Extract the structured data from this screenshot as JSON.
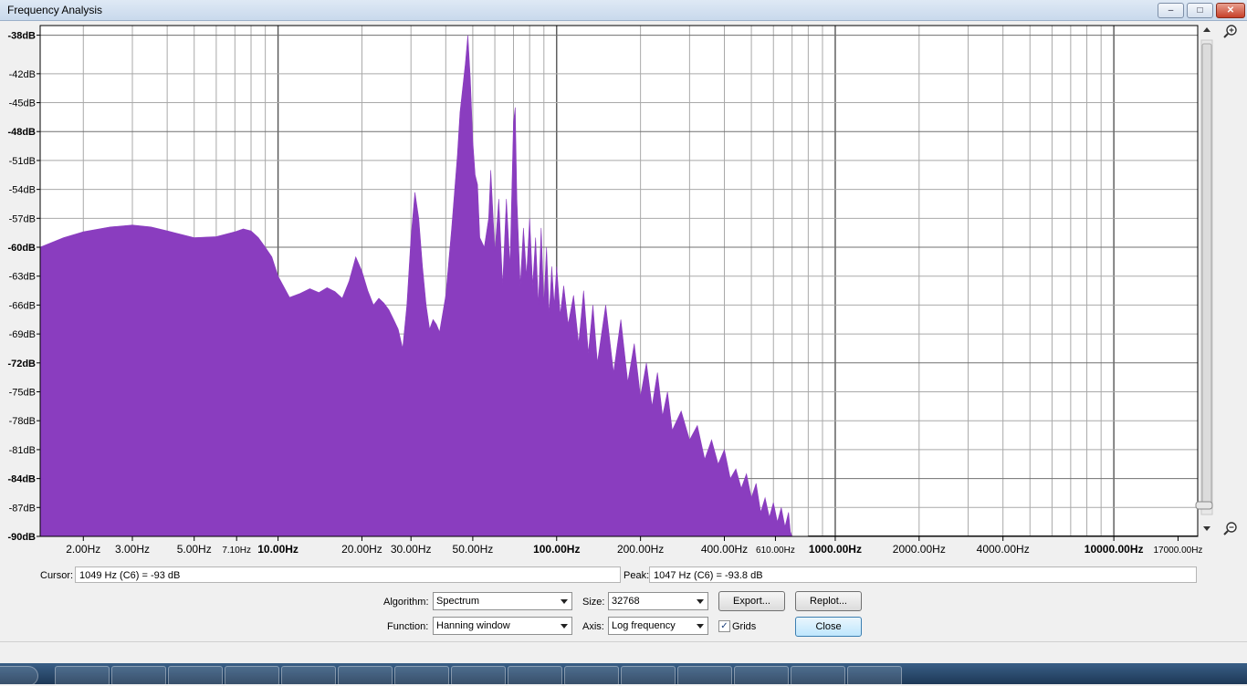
{
  "window": {
    "title": "Frequency Analysis",
    "minimize_glyph": "–",
    "maximize_glyph": "□",
    "close_glyph": "✕"
  },
  "chart_data": {
    "type": "area",
    "title": "",
    "xlabel": "",
    "ylabel": "",
    "x_scale": "log",
    "xlim": [
      1.4,
      20000
    ],
    "ylim": [
      -90,
      -37
    ],
    "grid": true,
    "fill_color": "#8a3dbf",
    "x_ticks": [
      {
        "value": 2,
        "label": "2.00Hz",
        "bold": false
      },
      {
        "value": 3,
        "label": "3.00Hz",
        "bold": false
      },
      {
        "value": 5,
        "label": "5.00Hz",
        "bold": false
      },
      {
        "value": 7.1,
        "label": "7.10Hz",
        "bold": false
      },
      {
        "value": 10,
        "label": "10.00Hz",
        "bold": true
      },
      {
        "value": 20,
        "label": "20.00Hz",
        "bold": false
      },
      {
        "value": 30,
        "label": "30.00Hz",
        "bold": false
      },
      {
        "value": 50,
        "label": "50.00Hz",
        "bold": false
      },
      {
        "value": 100,
        "label": "100.00Hz",
        "bold": true
      },
      {
        "value": 200,
        "label": "200.00Hz",
        "bold": false
      },
      {
        "value": 400,
        "label": "400.00Hz",
        "bold": false
      },
      {
        "value": 610,
        "label": "610.00Hz",
        "bold": false
      },
      {
        "value": 1000,
        "label": "1000.00Hz",
        "bold": true
      },
      {
        "value": 2000,
        "label": "2000.00Hz",
        "bold": false
      },
      {
        "value": 4000,
        "label": "4000.00Hz",
        "bold": false
      },
      {
        "value": 10000,
        "label": "10000.00Hz",
        "bold": true
      },
      {
        "value": 17000,
        "label": "17000.00Hz",
        "bold": false
      }
    ],
    "y_ticks": [
      {
        "value": -38,
        "label": "-38dB",
        "bold": true
      },
      {
        "value": -42,
        "label": "-42dB",
        "bold": false
      },
      {
        "value": -45,
        "label": "-45dB",
        "bold": false
      },
      {
        "value": -48,
        "label": "-48dB",
        "bold": true
      },
      {
        "value": -51,
        "label": "-51dB",
        "bold": false
      },
      {
        "value": -54,
        "label": "-54dB",
        "bold": false
      },
      {
        "value": -57,
        "label": "-57dB",
        "bold": false
      },
      {
        "value": -60,
        "label": "-60dB",
        "bold": true
      },
      {
        "value": -63,
        "label": "-63dB",
        "bold": false
      },
      {
        "value": -66,
        "label": "-66dB",
        "bold": false
      },
      {
        "value": -69,
        "label": "-69dB",
        "bold": false
      },
      {
        "value": -72,
        "label": "-72dB",
        "bold": true
      },
      {
        "value": -75,
        "label": "-75dB",
        "bold": false
      },
      {
        "value": -78,
        "label": "-78dB",
        "bold": false
      },
      {
        "value": -81,
        "label": "-81dB",
        "bold": false
      },
      {
        "value": -84,
        "label": "-84dB",
        "bold": true
      },
      {
        "value": -87,
        "label": "-87dB",
        "bold": false
      },
      {
        "value": -90,
        "label": "-90dB",
        "bold": true
      }
    ],
    "series": [
      {
        "x": [
          1.4,
          1.7,
          2.0,
          2.5,
          3.0,
          3.5,
          4.0,
          5.0,
          6.0,
          7.0,
          7.5,
          8.0,
          8.5,
          9.0,
          9.5,
          10.0,
          11.0,
          12.0,
          13.0,
          14.0,
          15.0,
          16.0,
          17.0,
          18.0,
          19.0,
          20.0,
          21.0,
          22.0,
          23.0,
          24.0,
          25.0,
          26.0,
          27.0,
          28.0,
          29.0,
          30.0,
          31.0,
          32.0,
          33.0,
          34.0,
          35.0,
          36.0,
          37.0,
          38.0,
          40.0,
          42.0,
          44.0,
          45.0,
          46.0,
          47.0,
          48.0,
          49.0,
          50.0,
          51.0,
          52.0,
          53.0,
          55.0,
          57.0,
          58.0,
          60.0,
          62.0,
          64.0,
          66.0,
          68.0,
          70.0,
          71.0,
          72.0,
          74.0,
          76.0,
          78.0,
          80.0,
          82.0,
          84.0,
          86.0,
          88.0,
          90.0,
          92.0,
          94.0,
          96.0,
          98.0,
          100.0,
          103.0,
          106.0,
          110.0,
          115.0,
          120.0,
          125.0,
          130.0,
          135.0,
          140.0,
          150.0,
          160.0,
          170.0,
          180.0,
          190.0,
          200.0,
          210.0,
          220.0,
          230.0,
          240.0,
          250.0,
          260.0,
          280.0,
          300.0,
          320.0,
          340.0,
          360.0,
          380.0,
          400.0,
          420.0,
          440.0,
          460.0,
          480.0,
          500.0,
          520.0,
          540.0,
          560.0,
          580.0,
          600.0,
          620.0,
          640.0,
          660.0,
          680.0,
          690.0,
          700.0,
          720.0,
          740.0,
          760.0,
          780.0,
          800.0
        ],
        "y": [
          -60.0,
          -59.0,
          -58.4,
          -57.9,
          -57.7,
          -57.9,
          -58.3,
          -59.0,
          -58.9,
          -58.4,
          -58.1,
          -58.3,
          -59.0,
          -60.0,
          -61.0,
          -63.0,
          -65.2,
          -64.8,
          -64.3,
          -64.7,
          -64.2,
          -64.6,
          -65.3,
          -63.5,
          -61.0,
          -62.5,
          -64.5,
          -66.0,
          -65.3,
          -65.8,
          -66.5,
          -67.5,
          -68.5,
          -70.5,
          -66.0,
          -59.0,
          -54.3,
          -57.0,
          -62.0,
          -66.0,
          -68.5,
          -67.5,
          -68.0,
          -68.8,
          -65.0,
          -58.0,
          -50.5,
          -46.0,
          -43.5,
          -41.0,
          -38.0,
          -42.5,
          -49.0,
          -52.5,
          -53.5,
          -59.0,
          -60.0,
          -57.0,
          -52.0,
          -60.5,
          -55.0,
          -64.0,
          -55.0,
          -62.0,
          -47.0,
          -45.5,
          -55.0,
          -64.0,
          -58.0,
          -63.0,
          -57.0,
          -64.0,
          -59.0,
          -66.0,
          -58.0,
          -66.0,
          -60.0,
          -67.0,
          -62.0,
          -66.0,
          -62.0,
          -67.0,
          -64.0,
          -68.0,
          -65.0,
          -70.0,
          -64.5,
          -71.0,
          -66.0,
          -72.0,
          -66.0,
          -73.0,
          -67.5,
          -74.0,
          -70.0,
          -75.5,
          -72.0,
          -76.5,
          -73.0,
          -77.5,
          -75.0,
          -79.0,
          -77.0,
          -80.0,
          -78.5,
          -82.0,
          -80.0,
          -82.5,
          -81.0,
          -84.0,
          -83.0,
          -85.0,
          -83.5,
          -86.0,
          -84.5,
          -87.5,
          -86.0,
          -88.0,
          -86.5,
          -88.5,
          -87.0,
          -89.0,
          -87.5,
          -89.5,
          -90.0,
          -90.0,
          -90.0,
          -90.0,
          -90.0,
          -90.0
        ]
      }
    ]
  },
  "controls": {
    "cursor_label": "Cursor:",
    "cursor_value": "1049 Hz (C6) = -93 dB",
    "peak_label": "Peak:",
    "peak_value": "1047 Hz (C6) = -93.8 dB",
    "algorithm_label": "Algorithm:",
    "algorithm_value": "Spectrum",
    "size_label": "Size:",
    "size_value": "32768",
    "export_button": "Export...",
    "replot_button": "Replot...",
    "function_label": "Function:",
    "function_value": "Hanning window",
    "axis_label": "Axis:",
    "axis_value": "Log frequency",
    "grids_label": "Grids",
    "grids_checked": true,
    "close_button": "Close"
  }
}
